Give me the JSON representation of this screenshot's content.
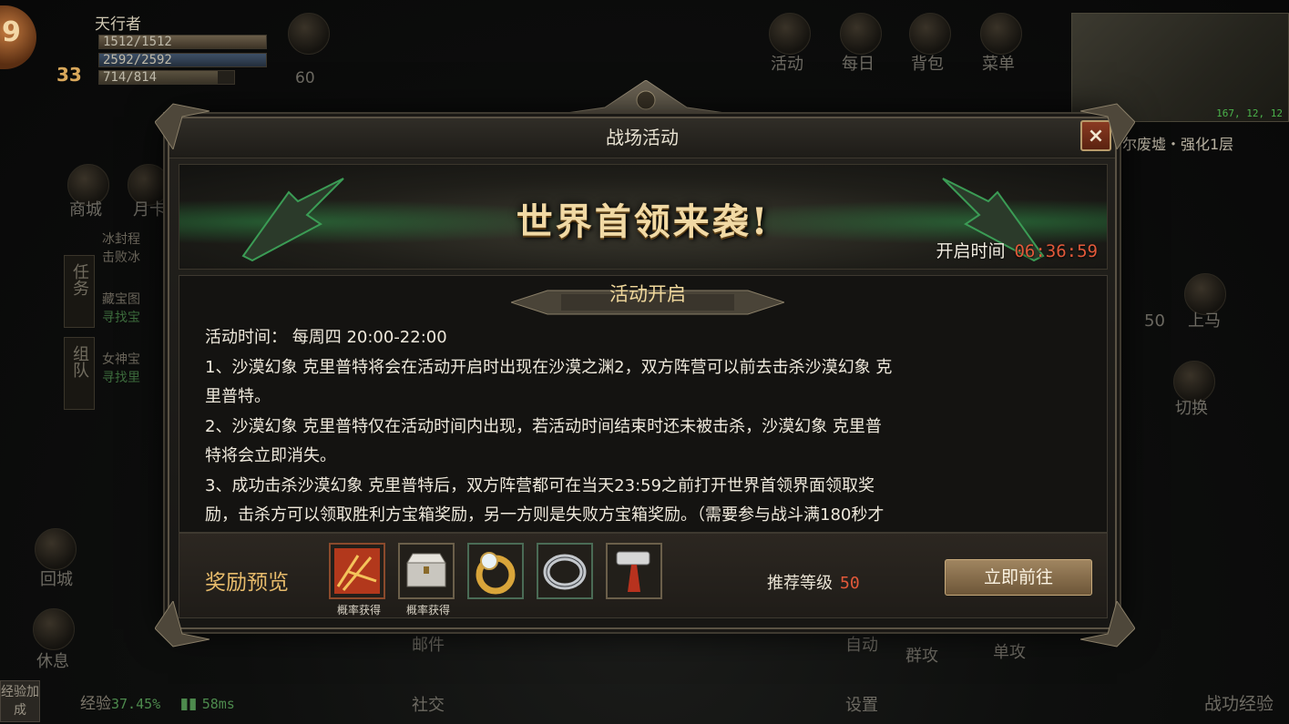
{
  "hud": {
    "player_name": "天行者",
    "avatar_level": "9",
    "hp": "1512/1512",
    "mp": "2592/2592",
    "xp": "714/814",
    "level": "33",
    "circle_value": "60",
    "top_menu": [
      "活动",
      "每日",
      "背包",
      "菜单"
    ],
    "left_menu": [
      "商城",
      "月卡"
    ],
    "side_tabs": [
      "任务",
      "组队"
    ],
    "quests": [
      {
        "name": "冰封程",
        "desc": "击败冰"
      },
      {
        "name": "藏宝图",
        "desc": "寻找宝"
      },
      {
        "name": "女神宝",
        "desc": "寻找里"
      }
    ],
    "left_bottom": [
      "回城",
      "休息"
    ],
    "right_side": [
      "上马",
      "切换"
    ],
    "right_num": "50",
    "bottom_menu": [
      "邮件",
      "社交",
      "自动",
      "设置",
      "群攻",
      "单攻"
    ],
    "minimap_coord": "167, 12, 12",
    "map_name": "尔废墟・强化1层",
    "exp_badge": "经验加成",
    "exp_label": "经验",
    "exp_value": "37.45%",
    "ping": "58ms",
    "merit_exp": "战功经验"
  },
  "dialog": {
    "title": "战场活动",
    "close_label": "×",
    "banner_title": "世界首领来袭!",
    "open_time_label": "开启时间",
    "open_time_value": "06:36:59",
    "section_title": "活动开启",
    "lines": [
      "活动时间：  每周四 20:00-22:00",
      "1、沙漠幻象 克里普特将会在活动开启时出现在沙漠之渊2，双方阵营可以前去击杀沙漠幻象 克",
      "里普特。",
      "2、沙漠幻象 克里普特仅在活动时间内出现，若活动时间结束时还未被击杀，沙漠幻象 克里普",
      "特将会立即消失。",
      "3、成功击杀沙漠幻象 克里普特后，双方阵营都可在当天23:59之前打开世界首领界面领取奖",
      "励，击杀方可以领取胜利方宝箱奖励，另一方则是失败方宝箱奖励。（需要参与战斗满180秒才"
    ],
    "reward_label": "奖励预览",
    "rewards": [
      {
        "icon": "red-chest-icon",
        "caption": "概率获得"
      },
      {
        "icon": "silver-chest-icon",
        "caption": "概率获得"
      },
      {
        "icon": "gold-ring-icon",
        "caption": ""
      },
      {
        "icon": "silver-ring-icon",
        "caption": ""
      },
      {
        "icon": "hammer-icon",
        "caption": ""
      }
    ],
    "recommend_label": "推荐等级",
    "recommend_level": "50",
    "go_button": "立即前往"
  }
}
